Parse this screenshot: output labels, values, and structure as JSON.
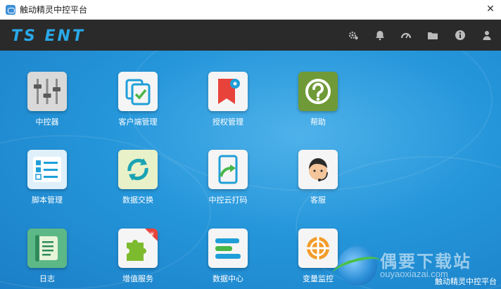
{
  "window": {
    "title": "触动精灵中控平台"
  },
  "header": {
    "logo_text": "TS ENT",
    "icons": [
      "settings-gear-icon",
      "bell-icon",
      "speedometer-icon",
      "folder-icon",
      "info-icon",
      "user-icon"
    ]
  },
  "tiles": [
    {
      "label": "中控器",
      "icon": "sliders-icon",
      "color": "#d8d8d8"
    },
    {
      "label": "客户端管理",
      "icon": "client-check-icon",
      "color": "#f4f4f4"
    },
    {
      "label": "授权管理",
      "icon": "bookmark-gear-icon",
      "color": "#f4f4f4"
    },
    {
      "label": "帮助",
      "icon": "help-icon",
      "color": "#6f9a37"
    },
    {
      "label": "脚本管理",
      "icon": "checklist-icon",
      "color": "#dfeef8"
    },
    {
      "label": "数据交换",
      "icon": "sync-icon",
      "color": "#e8f0c8"
    },
    {
      "label": "中控云打码",
      "icon": "cloud-code-icon",
      "color": "#f4f4f4"
    },
    {
      "label": "客服",
      "icon": "customer-service-icon",
      "color": "#f4f4f4"
    },
    {
      "label": "日志",
      "icon": "scroll-log-icon",
      "color": "#5db887"
    },
    {
      "label": "增值服务",
      "icon": "puzzle-yuan-icon",
      "color": "#f4f4f4"
    },
    {
      "label": "数据中心",
      "icon": "data-bars-icon",
      "color": "#f4f4f4"
    },
    {
      "label": "变量监控",
      "icon": "monitor-target-icon",
      "color": "#f4f4f4"
    }
  ],
  "watermark": {
    "cn": "偶要下载站",
    "url": "ouyaoxiazai.com"
  },
  "statusbar": {
    "text": "触动精灵中控平台"
  }
}
